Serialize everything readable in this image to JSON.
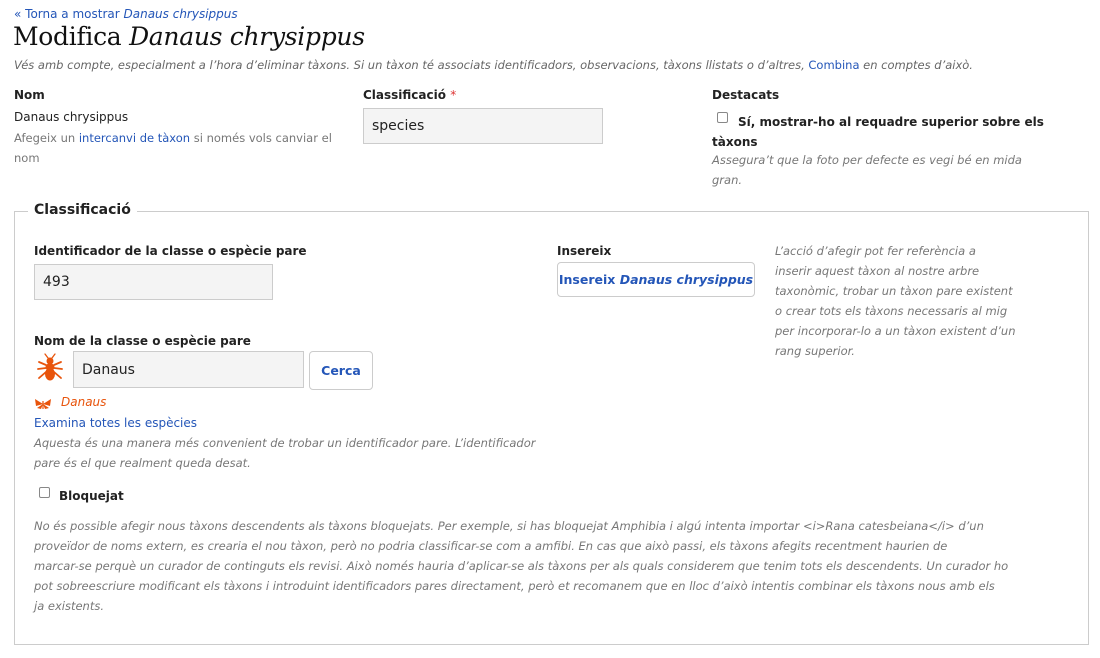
{
  "back_link": {
    "prefix": "« Torna a mostrar",
    "taxon": "Danaus chrysippus"
  },
  "title": {
    "prefix": "Modifica",
    "taxon": "Danaus chrysippus"
  },
  "warning": {
    "text": "Vés amb compte, especialment a l’hora d’eliminar tàxons. Si un tàxon té associats identificadors, observacions, tàxons llistats o d’altres,",
    "link": "Combina",
    "suffix": "en comptes d’això."
  },
  "name": {
    "label": "Nom",
    "value": "Danaus chrysippus",
    "hint_prefix": "Afegeix un",
    "hint_link": "intercanvi de tàxon",
    "hint_mid": "si només vols canviar el",
    "hint_end": "nom"
  },
  "rank": {
    "label": "Classificació",
    "required": "*",
    "value": "species"
  },
  "featured": {
    "label": "Destacats",
    "check_line1": "Sí, mostrar-ho al requadre superior sobre els",
    "check_line2": "tàxons",
    "hint_line1": "Assegura’t que la foto per defecte es vegi bé en mida",
    "hint_line2": "gran."
  },
  "classification": {
    "legend": "Classificació",
    "parent_id": {
      "label": "Identificador de la classe o espècie pare",
      "value": "493"
    },
    "graft": {
      "label": "Insereix",
      "button_prefix": "Insereix",
      "button_taxon": "Danaus chrysippus"
    },
    "graft_hint": [
      "L’acció d’afegir pot fer referència a",
      "inserir aquest tàxon al nostre arbre",
      "taxonòmic, trobar un tàxon pare existent",
      "o crear tots els tàxons necessaris al mig",
      "per incorporar-lo a un tàxon existent d’un",
      "rang superior."
    ],
    "parent_name": {
      "label": "Nom de la classe o espècie pare",
      "value": "Danaus",
      "search_button": "Cerca"
    },
    "selected_taxon": "Danaus",
    "browse_link": "Examina totes les espècies",
    "parent_hint": [
      "Aquesta és una manera més convenient de trobar un identificador pare. L’identificador",
      "pare és el que realment queda desat."
    ],
    "locked": {
      "label": "Bloquejat"
    },
    "locked_hint": [
      "No és possible afegir nous tàxons descendents als tàxons bloquejats. Per exemple, si has bloquejat Amphibia i algú intenta importar <i>Rana catesbeiana</i> d’un",
      "proveïdor de noms extern, es crearia el nou tàxon, però no podria classificar-se com a amfibi. En cas que això passi, els tàxons afegits recentment haurien de",
      "marcar-se perquè un curador de continguts els revisi. Això només hauria d’aplicar-se als tàxons per als quals considerem que tenim tots els descendents. Un curador ho",
      "pot sobreescriure modificant els tàxons i introduint identificadors pares directament, però et recomanem que en lloc d’això intentis combinar els tàxons nous amb els",
      "ja existents."
    ]
  },
  "colors": {
    "link": "#2456b8",
    "insect": "#e8540c"
  },
  "icons": {
    "insect": "insect-icon"
  }
}
